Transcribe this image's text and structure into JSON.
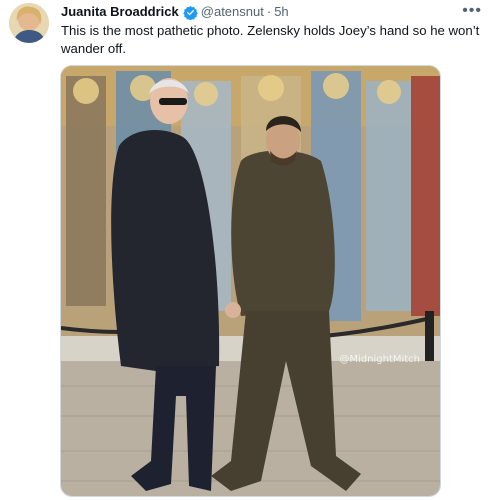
{
  "tweet": {
    "author_name": "Juanita Broaddrick",
    "handle": "@atensnut",
    "separator": "·",
    "time": "5h",
    "more_label": "•••",
    "text": "This is the most pathetic photo.  Zelensky holds Joey’s hand so he won’t wander off.",
    "photo_watermark": "@MidnightMitch",
    "colors": {
      "verified": "#1d9bf0",
      "secondary_text": "#536471"
    },
    "icons": {
      "verified": "verified-badge-icon",
      "more": "more-icon"
    }
  }
}
